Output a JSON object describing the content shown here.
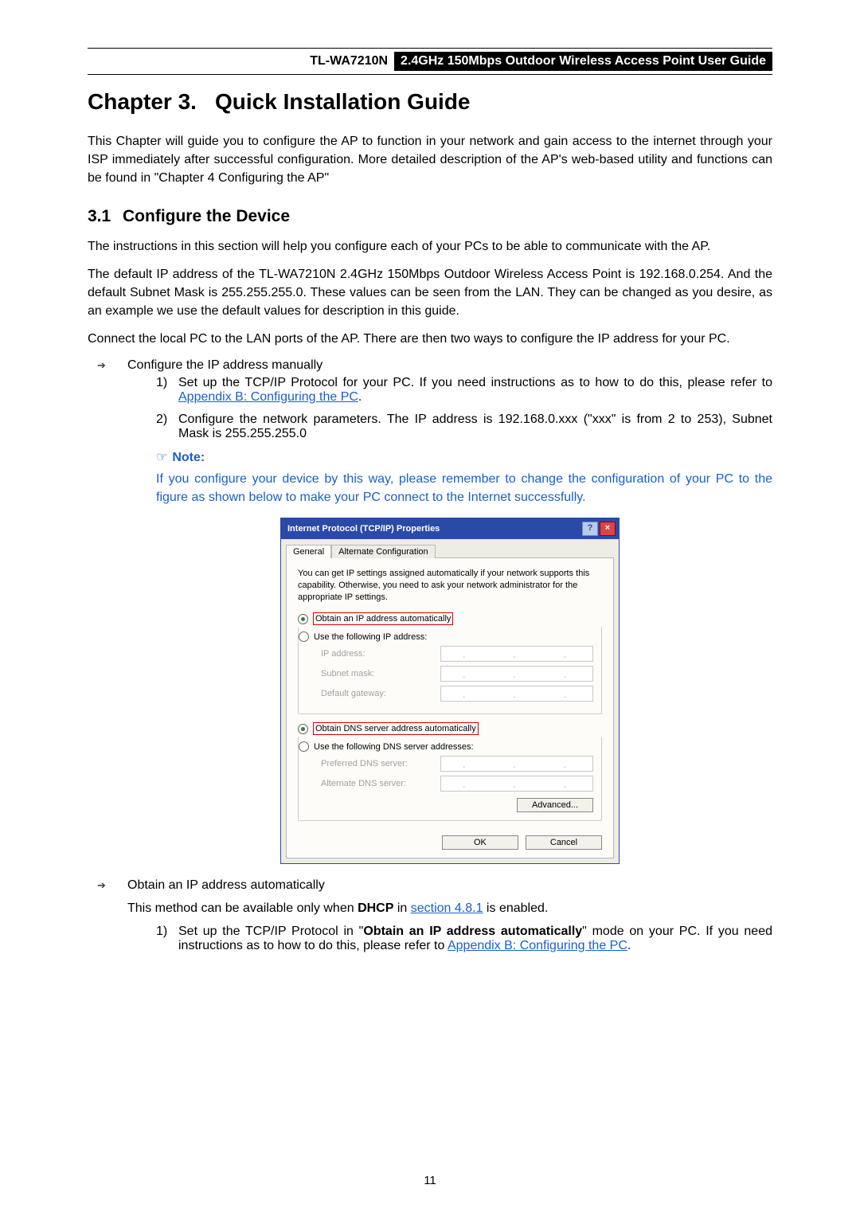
{
  "header": {
    "model": "TL-WA7210N",
    "desc": "2.4GHz 150Mbps Outdoor Wireless Access Point User Guide"
  },
  "chapter": {
    "num": "Chapter 3.",
    "title": "Quick Installation Guide"
  },
  "intro_para": "This Chapter will guide you to configure the AP to function in your network and gain access to the internet through your ISP immediately after successful configuration. More detailed description of the AP's web-based utility and functions can be found in \"Chapter 4 Configuring the AP\"",
  "section": {
    "num": "3.1",
    "title": "Configure the Device"
  },
  "p1": "The instructions in this section will help you configure each of your PCs to be able to communicate with the AP.",
  "p2": "The default IP address of the TL-WA7210N 2.4GHz 150Mbps Outdoor Wireless Access Point is 192.168.0.254. And the default Subnet Mask is 255.255.255.0. These values can be seen from the LAN. They can be changed as you desire, as an example we use the default values for description in this guide.",
  "p3": "Connect the local PC to the LAN ports of the AP. There are then two ways to configure the IP address for your PC.",
  "bullet1": "Configure the IP address manually",
  "step1_pre": "Set up the TCP/IP Protocol for your PC. If you need instructions as to how to do this, please refer to ",
  "link_appendixB": "Appendix B: Configuring the PC",
  "step1_post": ".",
  "step2": "Configure the network parameters. The IP address is 192.168.0.xxx (\"xxx\" is from 2 to 253), Subnet Mask is 255.255.255.0",
  "note_label": "Note:",
  "note_text": "If you configure your device by this way, please remember to change the configuration of your PC to the figure as shown below to make your PC connect to the Internet successfully.",
  "dialog": {
    "title": "Internet Protocol (TCP/IP) Properties",
    "tab_general": "General",
    "tab_alt": "Alternate Configuration",
    "desc": "You can get IP settings assigned automatically if your network supports this capability. Otherwise, you need to ask your network administrator for the appropriate IP settings.",
    "r1": "Obtain an IP address automatically",
    "r2": "Use the following IP address:",
    "f_ip": "IP address:",
    "f_mask": "Subnet mask:",
    "f_gw": "Default gateway:",
    "r3": "Obtain DNS server address automatically",
    "r4": "Use the following DNS server addresses:",
    "f_pdns": "Preferred DNS server:",
    "f_adns": "Alternate DNS server:",
    "btn_adv": "Advanced...",
    "btn_ok": "OK",
    "btn_cancel": "Cancel"
  },
  "bullet2": "Obtain an IP address automatically",
  "dhcp_line_a": "This method can be available only when ",
  "dhcp_bold": "DHCP",
  "dhcp_line_b": " in ",
  "link_section": "section 4.8.1",
  "dhcp_line_c": " is enabled.",
  "b2_step1_a": "Set up the TCP/IP Protocol in \"",
  "b2_step1_bold": "Obtain an IP address automatically",
  "b2_step1_b": "\" mode on your PC. If you need instructions as to how to do this, please refer to ",
  "b2_step1_c": ".",
  "page_number": "11"
}
